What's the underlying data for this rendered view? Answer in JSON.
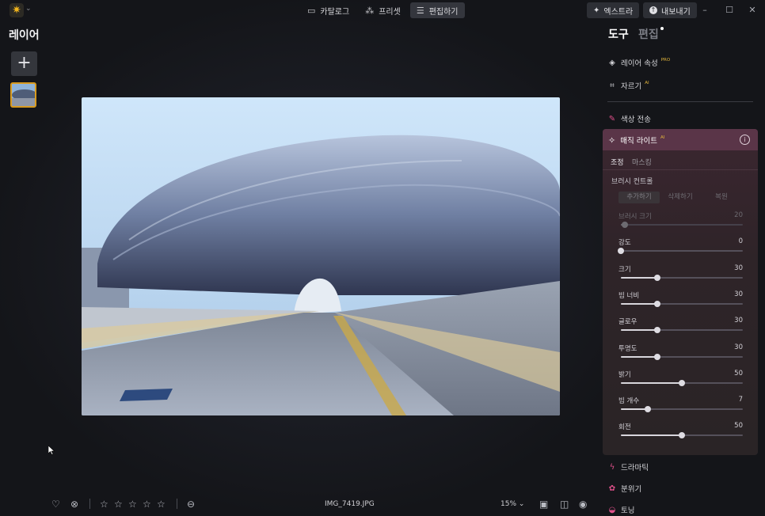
{
  "topbar": {
    "tabs": [
      {
        "label": "카탈로그",
        "icon": "folder-icon"
      },
      {
        "label": "프리셋",
        "icon": "sparkle-wand-icon"
      },
      {
        "label": "편집하기",
        "icon": "sliders-icon",
        "active": true
      }
    ],
    "extras_label": "엑스트라",
    "export_label": "내보내기",
    "window": {
      "minimize": "–",
      "maximize": "☐",
      "close": "✕"
    }
  },
  "layers": {
    "title": "레이어",
    "add": "+"
  },
  "photo": {
    "filename": "IMG_7419.JPG"
  },
  "bottombar": {
    "zoom": "15%",
    "zoom_caret": "⌄",
    "rating_stars": 5
  },
  "panel": {
    "title_tools": "도구",
    "title_edit": "편집",
    "tools_top": [
      {
        "label": "레이어 속성",
        "badge": "PRO",
        "icon": "layers-icon"
      },
      {
        "label": "자르기",
        "badge": "AI",
        "icon": "crop-icon"
      }
    ],
    "color_transfer": {
      "label": "색상 전송",
      "icon": "color-transfer-icon"
    },
    "magic_light": {
      "title": "매직 라이트",
      "badge": "AI",
      "subtabs": [
        {
          "label": "조정",
          "active": true
        },
        {
          "label": "마스킹",
          "active": false
        }
      ],
      "brush_control_label": "브러시 컨트롤",
      "brush_tabs": [
        {
          "label": "추가하기",
          "active": true
        },
        {
          "label": "삭제하기",
          "active": false
        },
        {
          "label": "복원",
          "active": false
        }
      ],
      "sliders": [
        {
          "label": "브러시 크기",
          "value": "20",
          "fraction": 0.03,
          "disabled": true
        },
        {
          "label": "강도",
          "value": "0",
          "fraction": 0.0
        },
        {
          "label": "크기",
          "value": "30",
          "fraction": 0.3
        },
        {
          "label": "빔 너비",
          "value": "30",
          "fraction": 0.3
        },
        {
          "label": "글로우",
          "value": "30",
          "fraction": 0.3
        },
        {
          "label": "투명도",
          "value": "30",
          "fraction": 0.3
        },
        {
          "label": "밝기",
          "value": "50",
          "fraction": 0.5
        },
        {
          "label": "빔 개수",
          "value": "7",
          "fraction": 0.22
        },
        {
          "label": "회전",
          "value": "50",
          "fraction": 0.5
        }
      ]
    },
    "tools_bottom": [
      {
        "label": "드라마틱",
        "icon": "lightning-icon",
        "color": "#e0508a"
      },
      {
        "label": "분위기",
        "icon": "atmosphere-icon",
        "color": "#e0508a"
      },
      {
        "label": "토닝",
        "icon": "toning-icon",
        "color": "#e0508a"
      }
    ]
  },
  "colors": {
    "accent": "#d89a1e",
    "magic_header": "#5a3548",
    "pink_icon": "#e0508a"
  }
}
